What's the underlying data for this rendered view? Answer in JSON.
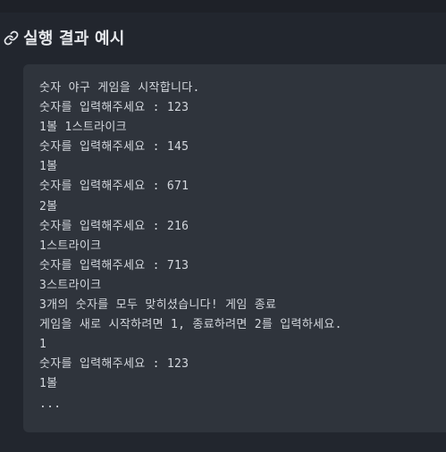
{
  "section": {
    "icon": "link-icon",
    "title": "실행 결과 예시"
  },
  "code": {
    "lines": [
      "숫자 야구 게임을 시작합니다.",
      "숫자를 입력해주세요 : 123",
      "1볼 1스트라이크",
      "숫자를 입력해주세요 : 145",
      "1볼",
      "숫자를 입력해주세요 : 671",
      "2볼",
      "숫자를 입력해주세요 : 216",
      "1스트라이크",
      "숫자를 입력해주세요 : 713",
      "3스트라이크",
      "3개의 숫자를 모두 맞히셨습니다! 게임 종료",
      "게임을 새로 시작하려면 1, 종료하려면 2를 입력하세요.",
      "1",
      "숫자를 입력해주세요 : 123",
      "1볼",
      "..."
    ]
  }
}
